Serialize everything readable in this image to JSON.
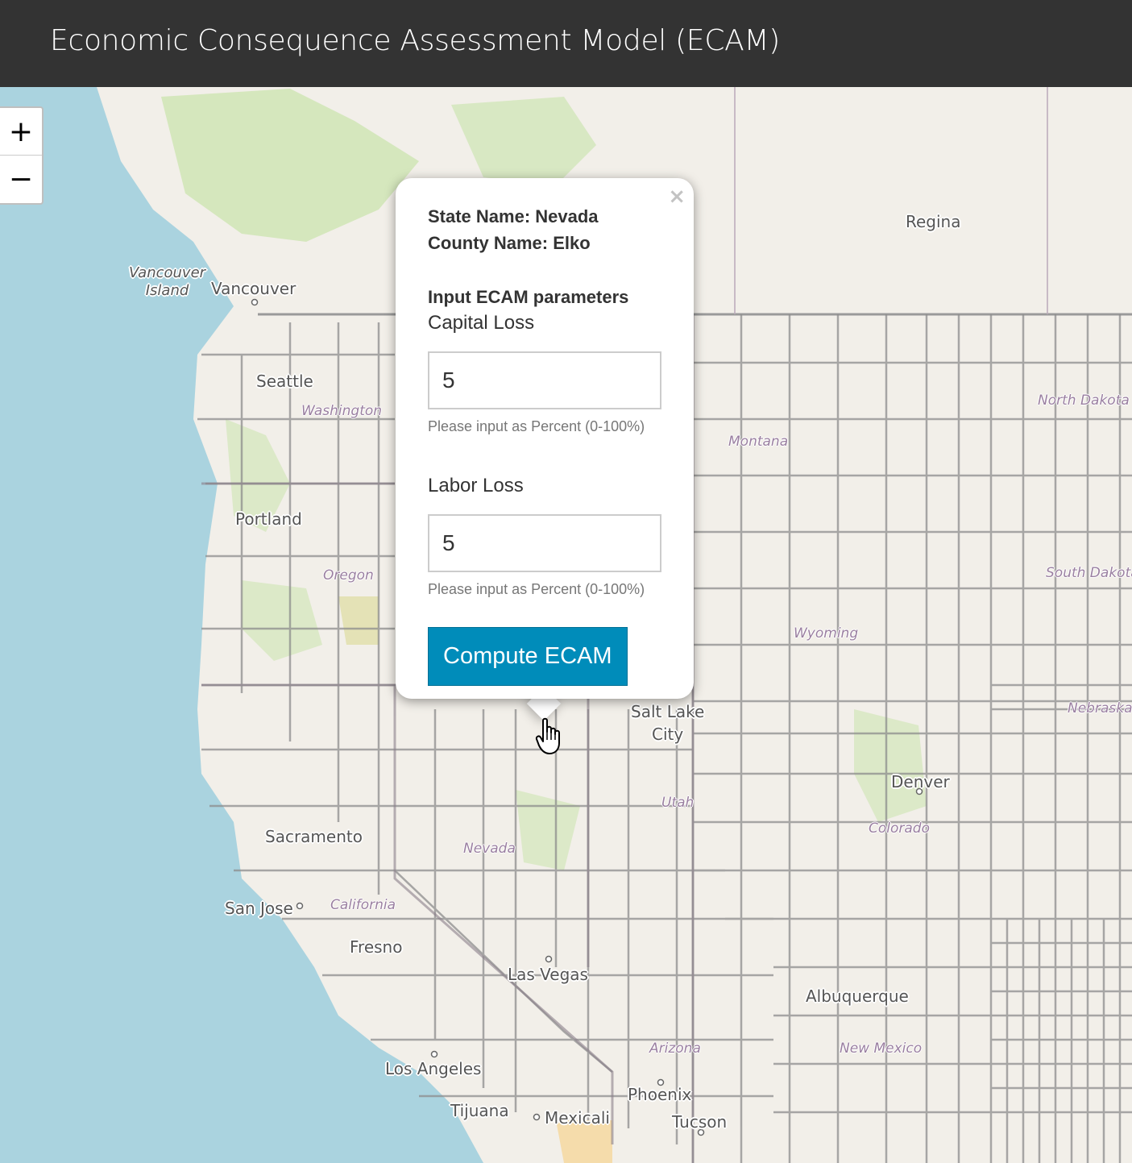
{
  "header": {
    "title": "Economic Consequence Assessment Model (ECAM)"
  },
  "zoom": {
    "in_label": "+",
    "out_label": "−"
  },
  "map": {
    "cities": {
      "vancouver_island": "Vancouver\nIsland",
      "vancouver": "Vancouver",
      "regina": "Regina",
      "seattle": "Seattle",
      "portland": "Portland",
      "salt_lake_city": "Salt Lake\nCity",
      "denver": "Denver",
      "sacramento": "Sacramento",
      "san_jose": "San Jose",
      "fresno": "Fresno",
      "las_vegas": "Las Vegas",
      "albuquerque": "Albuquerque",
      "los_angeles": "Los Angeles",
      "phoenix": "Phoenix",
      "tijuana": "Tijuana",
      "mexicali": "Mexicali",
      "tucson": "Tucson"
    },
    "states": {
      "washington": "Washington",
      "montana": "Montana",
      "north_dakota": "North Dakota",
      "oregon": "Oregon",
      "south_dakota": "South Dakota",
      "wyoming": "Wyoming",
      "nebraska": "Nebraska",
      "utah": "Utah",
      "colorado": "Colorado",
      "nevada": "Nevada",
      "california": "California",
      "arizona": "Arizona",
      "new_mexico": "New Mexico"
    }
  },
  "popup": {
    "close": "×",
    "state_line": "State Name: Nevada",
    "county_line": "County Name: Elko",
    "section_heading": "Input ECAM parameters",
    "capital": {
      "label": "Capital Loss",
      "value": "5",
      "help": "Please input as Percent (0-100%)"
    },
    "labor": {
      "label": "Labor Loss",
      "value": "5",
      "help": "Please input as Percent (0-100%)"
    },
    "button": "Compute ECAM"
  }
}
